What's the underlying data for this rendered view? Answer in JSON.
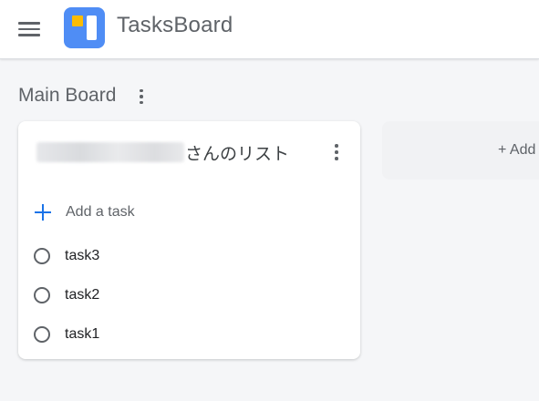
{
  "app": {
    "title": "TasksBoard"
  },
  "board": {
    "title": "Main Board"
  },
  "list": {
    "title": "さんのリスト",
    "add_task_label": "Add a task",
    "tasks": [
      {
        "label": "task3"
      },
      {
        "label": "task2"
      },
      {
        "label": "task1"
      }
    ]
  },
  "add_list": {
    "label": "+ Add"
  },
  "icons": {
    "menu": "hamburger-menu-icon",
    "logo": "tasksboard-logo",
    "more": "more-vert-icon",
    "add": "plus-icon",
    "check": "circle-checkbox-icon"
  },
  "colors": {
    "accent": "#1a73e8",
    "logo_blue": "#4f8df5",
    "logo_yellow": "#fbbc04",
    "background": "#f5f6f8"
  }
}
